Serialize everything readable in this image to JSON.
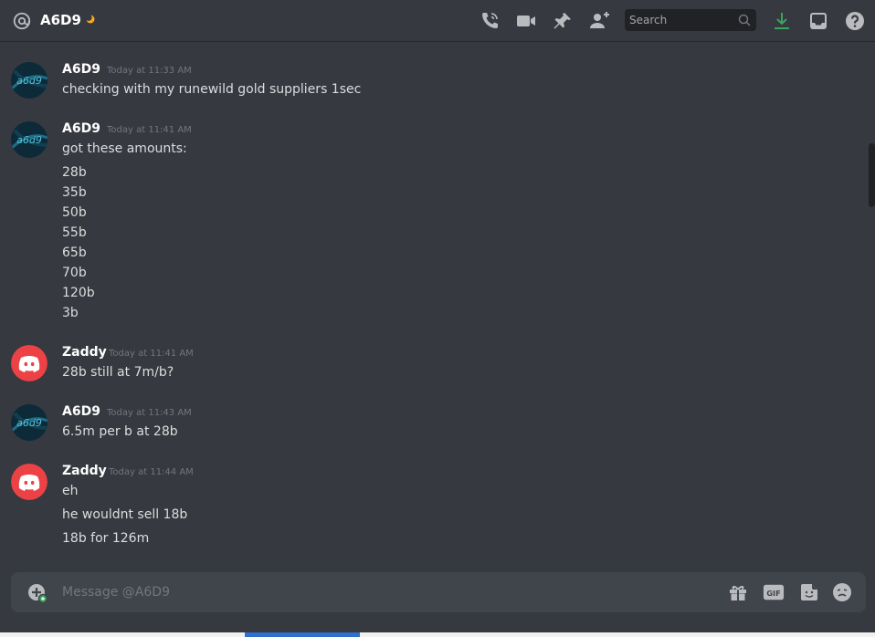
{
  "header": {
    "title": "A6D9",
    "search_placeholder": "Search",
    "icons": [
      "at-icon",
      "moon-icon",
      "voice-call-icon",
      "video-call-icon",
      "pin-icon",
      "add-friend-icon",
      "search-icon",
      "download-icon",
      "inbox-icon",
      "help-icon"
    ]
  },
  "messages": [
    {
      "author": "A6D9",
      "timestamp": "Today at 11:33 AM",
      "lines": [
        "checking with my runewild gold suppliers 1sec"
      ]
    },
    {
      "author": "A6D9",
      "timestamp": "Today at 11:41 AM",
      "lines": [
        "got these amounts:",
        "28b",
        "35b",
        "50b",
        "55b",
        "65b",
        "70b",
        "120b",
        "3b"
      ]
    },
    {
      "author": "Zaddy",
      "timestamp": "Today at 11:41 AM",
      "lines": [
        "28b still at 7m/b?"
      ]
    },
    {
      "author": "A6D9",
      "timestamp": "Today at 11:43 AM",
      "lines": [
        "6.5m per b at 28b"
      ]
    },
    {
      "author": "Zaddy",
      "timestamp": "Today at 11:44 AM",
      "lines": [
        "eh",
        "he wouldnt sell 18b",
        "18b for 126m"
      ]
    }
  ],
  "avatars": {
    "a6d9": {
      "text": "a6d9",
      "bg": "#0d2a38",
      "fg": "#4fc3d9"
    },
    "zaddy": {
      "bg": "#ed4245"
    }
  },
  "composer": {
    "placeholder": "Message @A6D9",
    "icons": [
      "add-attachment-icon",
      "gift-icon",
      "gif-icon",
      "sticker-icon",
      "emoji-icon"
    ],
    "gif_label": "GIF"
  },
  "colors": {
    "background": "#36393f",
    "header_text": "#ffffff",
    "timestamp": "#72767d",
    "download_accent": "#3ba55c",
    "moon_accent": "#faa81a"
  }
}
